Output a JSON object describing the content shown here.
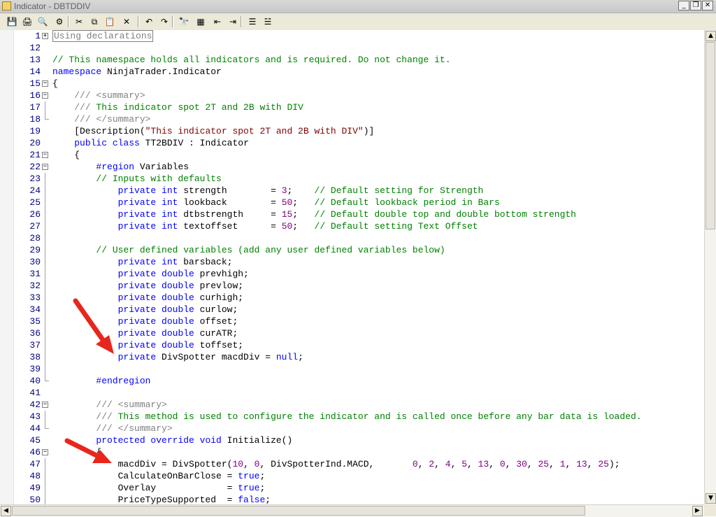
{
  "window": {
    "title": "Indicator - DBTDDIV"
  },
  "toolbar": {
    "buttons": [
      {
        "name": "save-button",
        "glyph": "💾"
      },
      {
        "name": "print-button",
        "glyph": "🖨"
      },
      {
        "name": "print-preview-button",
        "glyph": "🔍"
      },
      {
        "name": "compile-button",
        "glyph": "⚙"
      },
      {
        "name": "cut-button",
        "glyph": "✂"
      },
      {
        "name": "copy-button",
        "glyph": "⧉"
      },
      {
        "name": "paste-button",
        "glyph": "📋"
      },
      {
        "name": "delete-button",
        "glyph": "✕"
      },
      {
        "name": "undo-button",
        "glyph": "↶"
      },
      {
        "name": "redo-button",
        "glyph": "↷"
      },
      {
        "name": "find-button",
        "glyph": "🔭"
      },
      {
        "name": "find-replace-button",
        "glyph": "▦"
      },
      {
        "name": "outdent-button",
        "glyph": "⇤"
      },
      {
        "name": "indent-button",
        "glyph": "⇥"
      },
      {
        "name": "comment-button",
        "glyph": "☰"
      },
      {
        "name": "uncomment-button",
        "glyph": "☱"
      }
    ]
  },
  "colors": {
    "keyword": "#0000ff",
    "comment": "#008000",
    "string": "#800000",
    "number": "#800080",
    "line_number": "#000080"
  },
  "lines": [
    {
      "n": "1",
      "fold": "+",
      "tokens": [
        {
          "t": "Using declarations",
          "c": "box"
        }
      ]
    },
    {
      "n": "12",
      "tokens": []
    },
    {
      "n": "13",
      "tokens": [
        {
          "t": "// This namespace holds all indicators and is required. Do not change it.",
          "c": "c"
        }
      ]
    },
    {
      "n": "14",
      "tokens": [
        {
          "t": "namespace",
          "c": "k"
        },
        {
          "t": " NinjaTrader.Indicator"
        }
      ]
    },
    {
      "n": "15",
      "fold": "-",
      "tokens": [
        {
          "t": "{"
        }
      ]
    },
    {
      "n": "16",
      "fold": "-",
      "tokens": [
        {
          "t": "    "
        },
        {
          "t": "/// <summary>",
          "c": "g"
        }
      ]
    },
    {
      "n": "17",
      "vline": true,
      "tokens": [
        {
          "t": "    "
        },
        {
          "t": "///",
          "c": "g"
        },
        {
          "t": " This indicator spot 2T and 2B with DIV",
          "c": "c"
        }
      ]
    },
    {
      "n": "18",
      "end": true,
      "tokens": [
        {
          "t": "    "
        },
        {
          "t": "/// </summary>",
          "c": "g"
        }
      ]
    },
    {
      "n": "19",
      "tokens": [
        {
          "t": "    [Description("
        },
        {
          "t": "\"This indicator spot 2T and 2B with DIV\"",
          "c": "s"
        },
        {
          "t": ")]"
        }
      ]
    },
    {
      "n": "20",
      "tokens": [
        {
          "t": "    "
        },
        {
          "t": "public class",
          "c": "k"
        },
        {
          "t": " TT2BDIV : Indicator"
        }
      ]
    },
    {
      "n": "21",
      "fold": "-",
      "tokens": [
        {
          "t": "    {"
        }
      ]
    },
    {
      "n": "22",
      "fold": "-",
      "tokens": [
        {
          "t": "        "
        },
        {
          "t": "#region",
          "c": "k"
        },
        {
          "t": " Variables"
        }
      ]
    },
    {
      "n": "23",
      "vline": true,
      "tokens": [
        {
          "t": "        "
        },
        {
          "t": "// Inputs with defaults",
          "c": "c"
        }
      ]
    },
    {
      "n": "24",
      "vline": true,
      "tokens": [
        {
          "t": "            "
        },
        {
          "t": "private int",
          "c": "k"
        },
        {
          "t": " strength        = "
        },
        {
          "t": "3",
          "c": "n"
        },
        {
          "t": ";    "
        },
        {
          "t": "// Default setting for Strength",
          "c": "c"
        }
      ]
    },
    {
      "n": "25",
      "vline": true,
      "tokens": [
        {
          "t": "            "
        },
        {
          "t": "private int",
          "c": "k"
        },
        {
          "t": " lookback        = "
        },
        {
          "t": "50",
          "c": "n"
        },
        {
          "t": ";   "
        },
        {
          "t": "// Default lookback period in Bars",
          "c": "c"
        }
      ]
    },
    {
      "n": "26",
      "vline": true,
      "tokens": [
        {
          "t": "            "
        },
        {
          "t": "private int",
          "c": "k"
        },
        {
          "t": " dtbstrength     = "
        },
        {
          "t": "15",
          "c": "n"
        },
        {
          "t": ";   "
        },
        {
          "t": "// Default double top and double bottom strength",
          "c": "c"
        }
      ]
    },
    {
      "n": "27",
      "vline": true,
      "tokens": [
        {
          "t": "            "
        },
        {
          "t": "private int",
          "c": "k"
        },
        {
          "t": " textoffset      = "
        },
        {
          "t": "50",
          "c": "n"
        },
        {
          "t": ";   "
        },
        {
          "t": "// Default setting Text Offset",
          "c": "c"
        }
      ]
    },
    {
      "n": "28",
      "vline": true,
      "tokens": []
    },
    {
      "n": "29",
      "vline": true,
      "tokens": [
        {
          "t": "        "
        },
        {
          "t": "// User defined variables (add any user defined variables below)",
          "c": "c"
        }
      ]
    },
    {
      "n": "30",
      "vline": true,
      "tokens": [
        {
          "t": "            "
        },
        {
          "t": "private int",
          "c": "k"
        },
        {
          "t": " barsback;"
        }
      ]
    },
    {
      "n": "31",
      "vline": true,
      "tokens": [
        {
          "t": "            "
        },
        {
          "t": "private double",
          "c": "k"
        },
        {
          "t": " prevhigh;"
        }
      ]
    },
    {
      "n": "32",
      "vline": true,
      "tokens": [
        {
          "t": "            "
        },
        {
          "t": "private double",
          "c": "k"
        },
        {
          "t": " prevlow;"
        }
      ]
    },
    {
      "n": "33",
      "vline": true,
      "tokens": [
        {
          "t": "            "
        },
        {
          "t": "private double",
          "c": "k"
        },
        {
          "t": " curhigh;"
        }
      ]
    },
    {
      "n": "34",
      "vline": true,
      "tokens": [
        {
          "t": "            "
        },
        {
          "t": "private double",
          "c": "k"
        },
        {
          "t": " curlow;"
        }
      ]
    },
    {
      "n": "35",
      "vline": true,
      "tokens": [
        {
          "t": "            "
        },
        {
          "t": "private double",
          "c": "k"
        },
        {
          "t": " offset;"
        }
      ]
    },
    {
      "n": "36",
      "vline": true,
      "tokens": [
        {
          "t": "            "
        },
        {
          "t": "private double",
          "c": "k"
        },
        {
          "t": " curATR;"
        }
      ]
    },
    {
      "n": "37",
      "vline": true,
      "tokens": [
        {
          "t": "            "
        },
        {
          "t": "private double",
          "c": "k"
        },
        {
          "t": " toffset;"
        }
      ]
    },
    {
      "n": "38",
      "vline": true,
      "tokens": [
        {
          "t": "            "
        },
        {
          "t": "private",
          "c": "k"
        },
        {
          "t": " DivSpotter macdDiv = "
        },
        {
          "t": "null",
          "c": "k"
        },
        {
          "t": ";"
        }
      ]
    },
    {
      "n": "39",
      "vline": true,
      "tokens": []
    },
    {
      "n": "40",
      "end": true,
      "tokens": [
        {
          "t": "        "
        },
        {
          "t": "#endregion",
          "c": "k"
        }
      ]
    },
    {
      "n": "41",
      "tokens": []
    },
    {
      "n": "42",
      "fold": "-",
      "tokens": [
        {
          "t": "        "
        },
        {
          "t": "/// <summary>",
          "c": "g"
        }
      ]
    },
    {
      "n": "43",
      "vline": true,
      "tokens": [
        {
          "t": "        "
        },
        {
          "t": "///",
          "c": "g"
        },
        {
          "t": " This method is used to configure the indicator and is called once before any bar data is loaded.",
          "c": "c"
        }
      ]
    },
    {
      "n": "44",
      "end": true,
      "tokens": [
        {
          "t": "        "
        },
        {
          "t": "/// </summary>",
          "c": "g"
        }
      ]
    },
    {
      "n": "45",
      "tokens": [
        {
          "t": "        "
        },
        {
          "t": "protected override void",
          "c": "k"
        },
        {
          "t": " Initialize()"
        }
      ]
    },
    {
      "n": "46",
      "fold": "-",
      "tokens": [
        {
          "t": "        {"
        }
      ]
    },
    {
      "n": "47",
      "vline": true,
      "tokens": [
        {
          "t": "            macdDiv = DivSpotter("
        },
        {
          "t": "10",
          "c": "n"
        },
        {
          "t": ", "
        },
        {
          "t": "0",
          "c": "n"
        },
        {
          "t": ", DivSpotterInd.MACD,       "
        },
        {
          "t": "0",
          "c": "n"
        },
        {
          "t": ", "
        },
        {
          "t": "2",
          "c": "n"
        },
        {
          "t": ", "
        },
        {
          "t": "4",
          "c": "n"
        },
        {
          "t": ", "
        },
        {
          "t": "5",
          "c": "n"
        },
        {
          "t": ", "
        },
        {
          "t": "13",
          "c": "n"
        },
        {
          "t": ", "
        },
        {
          "t": "0",
          "c": "n"
        },
        {
          "t": ", "
        },
        {
          "t": "30",
          "c": "n"
        },
        {
          "t": ", "
        },
        {
          "t": "25",
          "c": "n"
        },
        {
          "t": ", "
        },
        {
          "t": "1",
          "c": "n"
        },
        {
          "t": ", "
        },
        {
          "t": "13",
          "c": "n"
        },
        {
          "t": ", "
        },
        {
          "t": "25",
          "c": "n"
        },
        {
          "t": ");"
        }
      ]
    },
    {
      "n": "48",
      "vline": true,
      "tokens": [
        {
          "t": "            CalculateOnBarClose = "
        },
        {
          "t": "true",
          "c": "k"
        },
        {
          "t": ";"
        }
      ]
    },
    {
      "n": "49",
      "vline": true,
      "tokens": [
        {
          "t": "            Overlay             = "
        },
        {
          "t": "true",
          "c": "k"
        },
        {
          "t": ";"
        }
      ]
    },
    {
      "n": "50",
      "vline": true,
      "tokens": [
        {
          "t": "            PriceTypeSupported  = "
        },
        {
          "t": "false",
          "c": "k"
        },
        {
          "t": ";"
        }
      ]
    }
  ],
  "annotations": {
    "arrow_color": "#e8261c"
  },
  "scrollbars": {
    "vertical_position": 0.0,
    "horizontal_position": 0.0
  }
}
